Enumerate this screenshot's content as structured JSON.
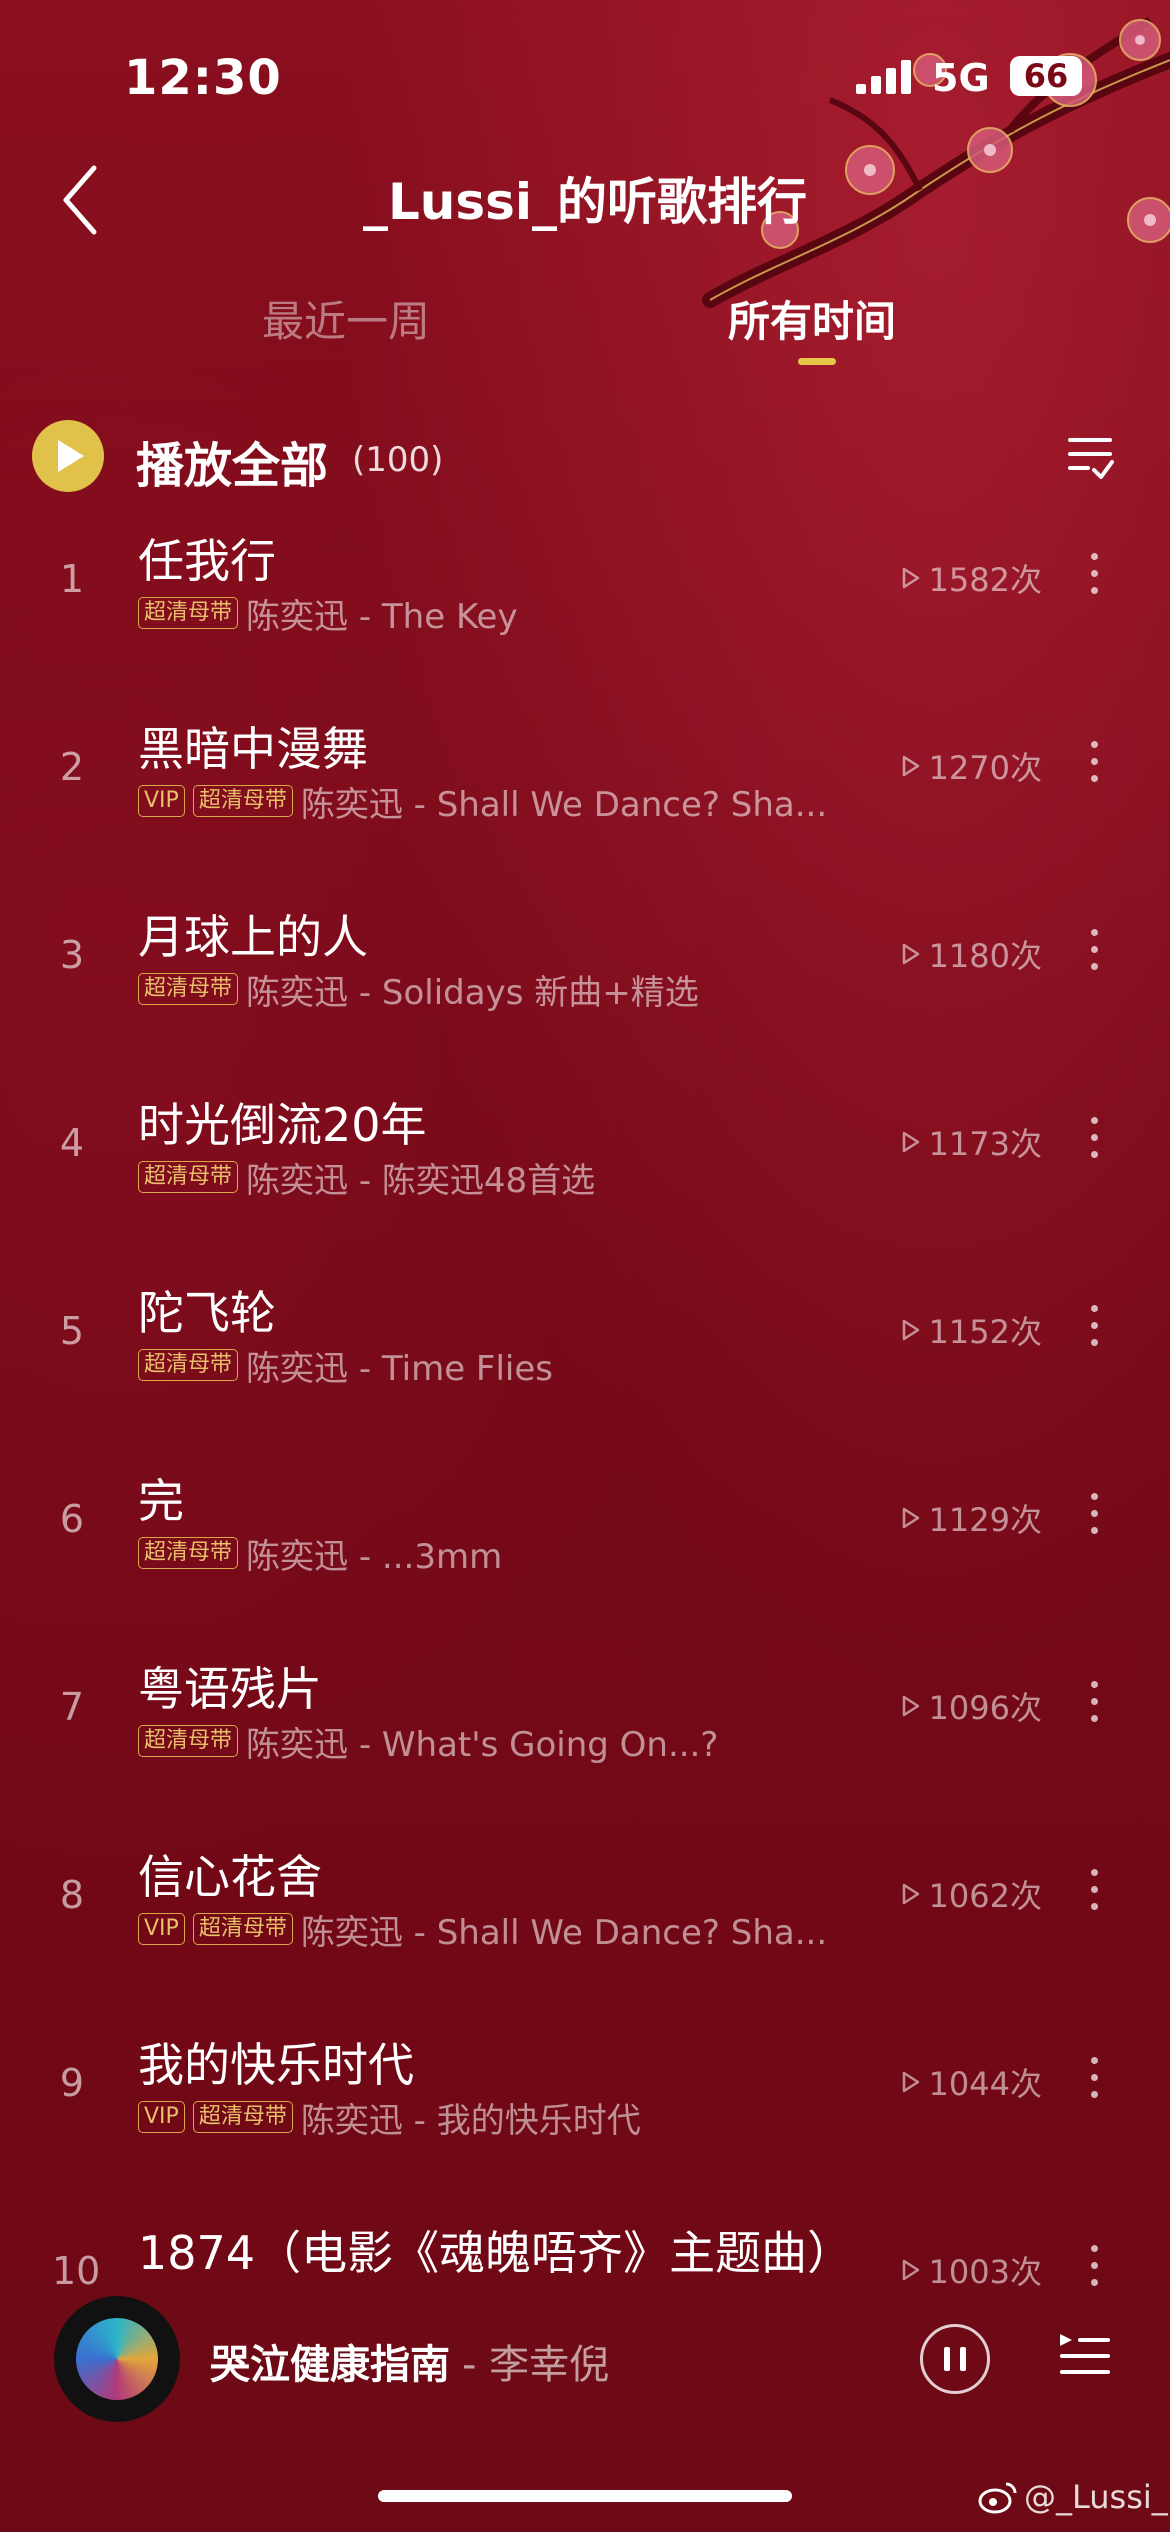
{
  "status_bar": {
    "time": "12:30",
    "network": "5G",
    "battery": "66"
  },
  "header": {
    "title": "_Lussi_的听歌排行"
  },
  "tabs": [
    {
      "label": "最近一周",
      "selected": false
    },
    {
      "label": "所有时间",
      "selected": true
    }
  ],
  "play_all": {
    "label": "播放全部",
    "count": "(100)"
  },
  "songs": [
    {
      "rank": "1",
      "title": "任我行",
      "badges": [
        "超清母带"
      ],
      "artist_album": "陈奕迅 - The Key",
      "plays": "1582次"
    },
    {
      "rank": "2",
      "title": "黑暗中漫舞",
      "badges": [
        "VIP",
        "超清母带"
      ],
      "artist_album": "陈奕迅 - Shall We Dance? Sha...",
      "plays": "1270次"
    },
    {
      "rank": "3",
      "title": "月球上的人",
      "badges": [
        "超清母带"
      ],
      "artist_album": "陈奕迅 - Solidays 新曲+精选",
      "plays": "1180次"
    },
    {
      "rank": "4",
      "title": "时光倒流20年",
      "badges": [
        "超清母带"
      ],
      "artist_album": "陈奕迅 - 陈奕迅48首选",
      "plays": "1173次"
    },
    {
      "rank": "5",
      "title": "陀飞轮",
      "badges": [
        "超清母带"
      ],
      "artist_album": "陈奕迅 - Time Flies",
      "plays": "1152次"
    },
    {
      "rank": "6",
      "title": "完",
      "badges": [
        "超清母带"
      ],
      "artist_album": "陈奕迅 - ...3mm",
      "plays": "1129次"
    },
    {
      "rank": "7",
      "title": "粤语残片",
      "badges": [
        "超清母带"
      ],
      "artist_album": "陈奕迅 - What's Going On...?",
      "plays": "1096次"
    },
    {
      "rank": "8",
      "title": "信心花舍",
      "badges": [
        "VIP",
        "超清母带"
      ],
      "artist_album": "陈奕迅 - Shall We Dance? Sha...",
      "plays": "1062次"
    },
    {
      "rank": "9",
      "title": "我的快乐时代",
      "badges": [
        "VIP",
        "超清母带"
      ],
      "artist_album": "陈奕迅 - 我的快乐时代",
      "plays": "1044次"
    },
    {
      "rank": "10",
      "title": "1874（电影《魂魄唔齐》主题曲）",
      "badges": [],
      "artist_album": "",
      "plays": "1003次"
    }
  ],
  "now_playing": {
    "title": "哭泣健康指南",
    "artist": "- 李幸倪"
  },
  "watermark": "@_Lussi_",
  "colors": {
    "background": "#7a0a17",
    "accent": "#e0c14a",
    "badge": "#d9a847"
  },
  "icons": [
    "back-icon",
    "play-icon",
    "multi-select-icon",
    "play-count-icon",
    "more-icon",
    "pause-icon",
    "playlist-icon",
    "weibo-icon"
  ]
}
